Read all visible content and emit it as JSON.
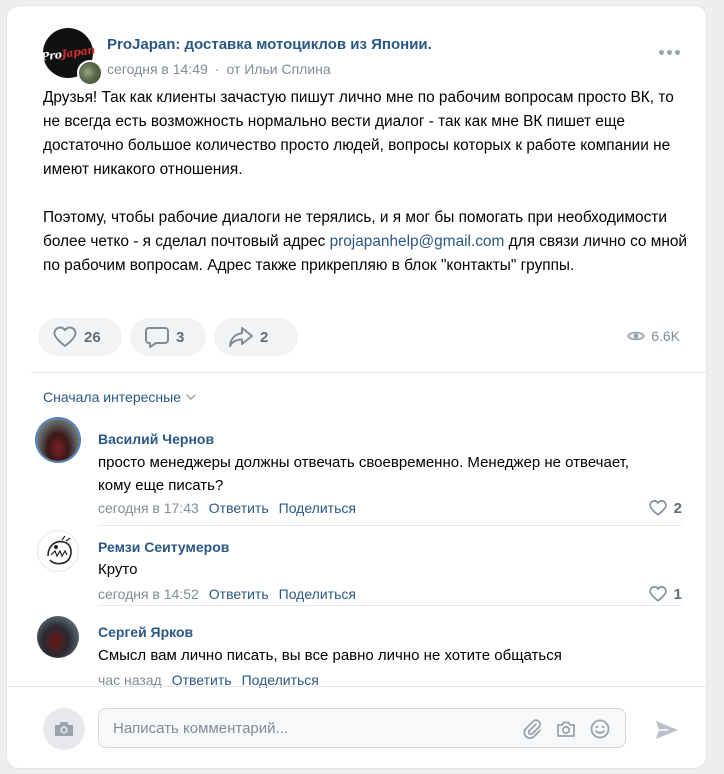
{
  "post": {
    "group_name": "ProJapan: доставка мотоциклов из Японии.",
    "logo_text_a": "Pro",
    "logo_text_b": "Japan",
    "time": "сегодня в 14:49",
    "author": "от Ильи Сплина",
    "paragraph1": "Друзья! Так как клиенты зачастую пишут лично мне по рабочим вопросам просто ВК, то не всегда есть возможность нормально вести диалог - так как мне ВК пишет еще достаточно большое количество просто людей, вопросы которых к работе компании не имеют никакого отношения.",
    "paragraph2_before": "Поэтому, чтобы рабочие диалоги не терялись, и я мог бы помогать при необходимости более четко - я сделал почтовый адрес ",
    "email": "projapanhelp@gmail.com",
    "paragraph2_after": " для связи лично со мной по рабочим вопросам. Адрес также прикрепляю в блок \"контакты\" группы."
  },
  "actions": {
    "likes": "26",
    "comments": "3",
    "shares": "2",
    "views": "6.6K"
  },
  "comments_sort": "Сначала интересные",
  "comments": [
    {
      "name": "Василий Чернов",
      "text": "просто менеджеры должны отвечать своевременно. Менеджер не отвечает, кому еще писать?",
      "time": "сегодня в 17:43",
      "reply": "Ответить",
      "share": "Поделиться",
      "likes": "2"
    },
    {
      "name": "Ремзи Сеитумеров",
      "text": "Круто",
      "time": "сегодня в 14:52",
      "reply": "Ответить",
      "share": "Поделиться",
      "likes": "1"
    },
    {
      "name": "Сергей Ярков",
      "text": "Смысл вам лично писать, вы все равно лично не хотите общаться",
      "time": "час назад",
      "reply": "Ответить",
      "share": "Поделиться"
    }
  ],
  "composer": {
    "placeholder": "Написать комментарий..."
  },
  "icons": {
    "more": "more-dots-icon",
    "like": "heart-icon",
    "comment": "comment-bubble-icon",
    "share": "share-arrow-icon",
    "views": "eye-icon",
    "camera": "camera-icon",
    "attach": "paperclip-icon",
    "photo": "photo-icon",
    "emoji": "smile-icon",
    "send": "send-icon",
    "chevron": "chevron-down-icon"
  },
  "colors": {
    "link": "#2a5885",
    "muted": "#818c99",
    "pill_bg": "#f2f3f5",
    "page_bg": "#edeef0"
  }
}
